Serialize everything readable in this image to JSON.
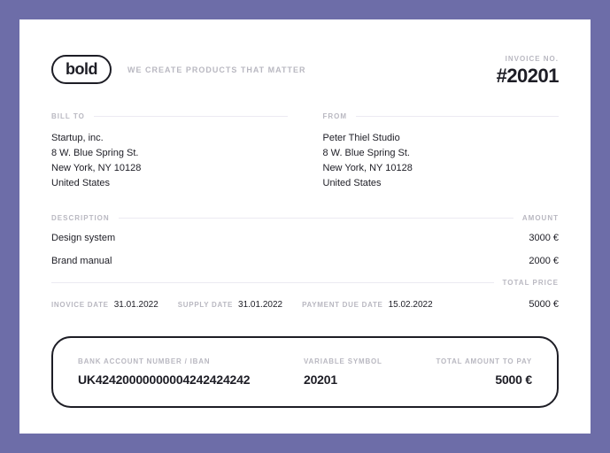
{
  "brand": {
    "logo_text": "bold",
    "tagline": "WE CREATE PRODUCTS THAT MATTER"
  },
  "invoice": {
    "number_label": "INVOICE NO.",
    "number": "#20201"
  },
  "bill_to": {
    "label": "BILL TO",
    "lines": [
      "Startup, inc.",
      "8 W. Blue Spring St.",
      "New York, NY 10128",
      "United States"
    ]
  },
  "from": {
    "label": "FROM",
    "lines": [
      "Peter Thiel Studio",
      "8 W. Blue Spring St.",
      "New York, NY 10128",
      "United States"
    ]
  },
  "items": {
    "desc_label": "DESCRIPTION",
    "amount_label": "AMOUNT",
    "rows": [
      {
        "desc": "Design system",
        "amount": "3000 €"
      },
      {
        "desc": "Brand manual",
        "amount": "2000 €"
      }
    ]
  },
  "totals": {
    "total_price_label": "TOTAL PRICE",
    "total_price": "5000 €"
  },
  "dates": {
    "invoice_date_label": "INOVICE DATE",
    "invoice_date": "31.01.2022",
    "supply_date_label": "SUPPLY DATE",
    "supply_date": "31.01.2022",
    "payment_due_label": "PAYMENT DUE DATE",
    "payment_due": "15.02.2022"
  },
  "summary": {
    "iban_label": "BANK ACCOUNT NUMBER / IBAN",
    "iban": "UK42420000000004242424242",
    "vs_label": "VARIABLE SYMBOL",
    "vs": "20201",
    "total_label": "TOTAL AMOUNT TO PAY",
    "total": "5000 €"
  }
}
